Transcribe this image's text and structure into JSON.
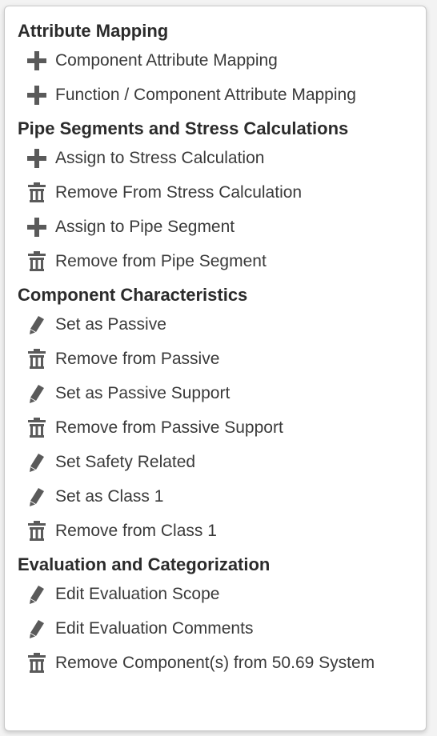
{
  "sections": [
    {
      "title": "Attribute Mapping",
      "items": [
        {
          "icon": "plus-icon",
          "label": "Component Attribute Mapping"
        },
        {
          "icon": "plus-icon",
          "label": "Function / Component Attribute Mapping"
        }
      ]
    },
    {
      "title": "Pipe Segments and Stress Calculations",
      "items": [
        {
          "icon": "plus-icon",
          "label": "Assign to Stress Calculation"
        },
        {
          "icon": "trash-icon",
          "label": "Remove From Stress Calculation"
        },
        {
          "icon": "plus-icon",
          "label": "Assign to Pipe Segment"
        },
        {
          "icon": "trash-icon",
          "label": "Remove from Pipe Segment"
        }
      ]
    },
    {
      "title": "Component Characteristics",
      "items": [
        {
          "icon": "pencil-icon",
          "label": "Set as Passive"
        },
        {
          "icon": "trash-icon",
          "label": "Remove from Passive"
        },
        {
          "icon": "pencil-icon",
          "label": "Set as Passive Support"
        },
        {
          "icon": "trash-icon",
          "label": "Remove from Passive Support"
        },
        {
          "icon": "pencil-icon",
          "label": "Set Safety Related"
        },
        {
          "icon": "pencil-icon",
          "label": "Set as Class 1"
        },
        {
          "icon": "trash-icon",
          "label": "Remove from Class 1"
        }
      ]
    },
    {
      "title": "Evaluation and Categorization",
      "items": [
        {
          "icon": "pencil-icon",
          "label": "Edit Evaluation Scope"
        },
        {
          "icon": "pencil-icon",
          "label": "Edit Evaluation Comments"
        },
        {
          "icon": "trash-icon",
          "label": "Remove Component(s) from 50.69 System"
        }
      ]
    }
  ],
  "colors": {
    "icon": "#5a5a5a",
    "text": "#3a3a3a",
    "heading": "#2b2b2b"
  }
}
